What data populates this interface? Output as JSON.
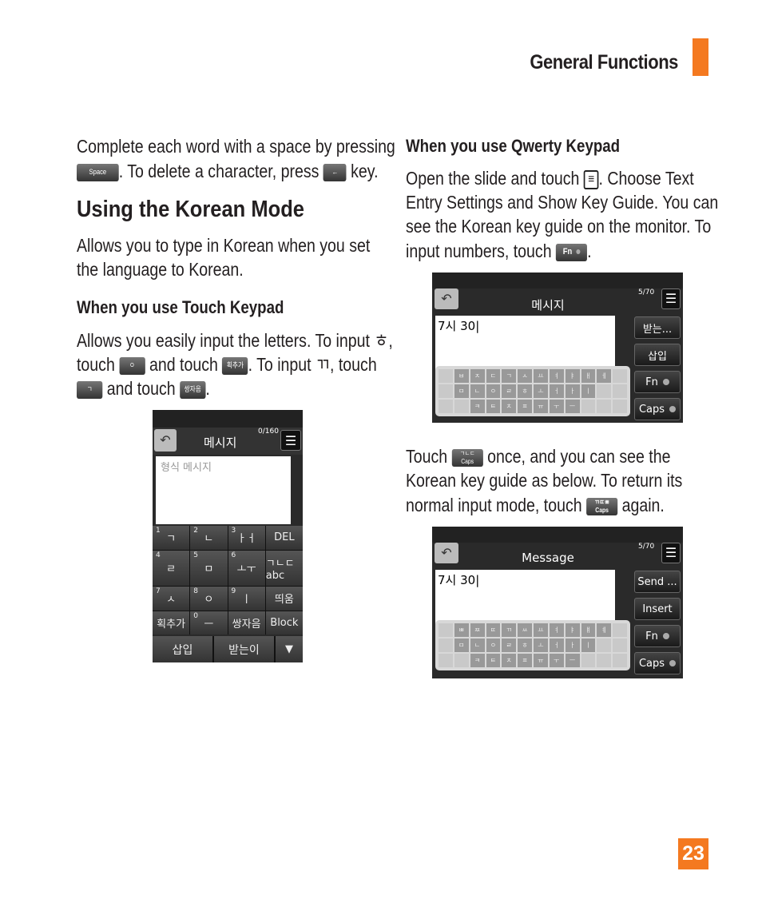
{
  "header": {
    "section": "General Functions",
    "accent": "#f47920"
  },
  "left": {
    "intro_line1": "Complete each word with a space by pressing",
    "intro_line2a": ". To delete a character, press",
    "intro_line2b": "key.",
    "key_space": "Space",
    "key_del": "Del",
    "title": "Using the Korean Mode",
    "desc1": "Allows you to type in Korean when you set",
    "desc2": "the language to Korean.",
    "touch_heading": "When you use Touch Keypad",
    "t1": "Allows you easily input the letters. To input ㅎ,",
    "t2a": "touch",
    "t2b": "and touch",
    "t2c": ". To input ㄲ, touch",
    "t3a": "and touch",
    "key8": "ㅇ",
    "key8n": "8",
    "key_add": "획추가",
    "key1": "ㄱ",
    "key1n": "1",
    "key_double": "쌍자음"
  },
  "right": {
    "qwerty_heading": "When you use Qwerty Keypad",
    "q1a": "Open the slide and touch",
    "q1b": ". Choose Text",
    "q2": "Entry Settings and Show Key Guide. You can",
    "q3": "see the Korean key guide on the monitor. To",
    "q4": "input numbers, touch",
    "key_fn": "Fn",
    "key_caps": "Caps",
    "key_caps_sub": "ㄱㄴㄷ",
    "key_caps_sub2": "ㄲㄸㅃ",
    "r1a": "Touch",
    "r1b": "once, and you can see the",
    "r2": "Korean key guide as below. To return its",
    "r3a": "normal input mode, touch",
    "r3b": "again."
  },
  "phone1": {
    "title": "메시지",
    "counter": "0/160",
    "placeholder": "형식 메시지",
    "keys": [
      [
        "1",
        "ㄱ"
      ],
      [
        "2",
        "ㄴ"
      ],
      [
        "3",
        "ㅏㅓ"
      ],
      [
        "",
        "DEL"
      ],
      [
        "4",
        "ㄹ"
      ],
      [
        "5",
        "ㅁ"
      ],
      [
        "6",
        "ㅗㅜ"
      ],
      [
        "",
        "ㄱㄴㄷ abc"
      ],
      [
        "7",
        "ㅅ"
      ],
      [
        "8",
        "ㅇ"
      ],
      [
        "9",
        "ㅣ"
      ],
      [
        "",
        "띄움"
      ],
      [
        "",
        "획추가"
      ],
      [
        "0",
        "ㅡ"
      ],
      [
        "",
        "쌍자음"
      ],
      [
        "",
        "Block"
      ]
    ],
    "bottom": [
      "삽입",
      "받는이"
    ]
  },
  "phone2": {
    "title": "메시지",
    "counter": "5/70",
    "text": "7시 30",
    "buttons": [
      "받는...",
      "삽입",
      "Fn",
      "Caps"
    ],
    "rows": [
      [
        "",
        "ㅂ",
        "ㅈ",
        "ㄷ",
        "ㄱ",
        "ㅅ",
        "ㅛ",
        "ㅕ",
        "ㅑ",
        "ㅐ",
        "ㅔ",
        ""
      ],
      [
        "",
        "ㅁ",
        "ㄴ",
        "ㅇ",
        "ㄹ",
        "ㅎ",
        "ㅗ",
        "ㅓ",
        "ㅏ",
        "ㅣ",
        "",
        ""
      ],
      [
        "",
        "",
        "ㅋ",
        "ㅌ",
        "ㅊ",
        "ㅍ",
        "ㅠ",
        "ㅜ",
        "ㅡ",
        "",
        "",
        ""
      ]
    ]
  },
  "phone3": {
    "title": "Message",
    "counter": "5/70",
    "text": "7시 30",
    "buttons": [
      "Send ...",
      "Insert",
      "Fn",
      "Caps"
    ],
    "rows": [
      [
        "",
        "ㅃ",
        "ㅉ",
        "ㄸ",
        "ㄲ",
        "ㅆ",
        "ㅛ",
        "ㅕ",
        "ㅑ",
        "ㅒ",
        "ㅖ",
        ""
      ],
      [
        "",
        "ㅁ",
        "ㄴ",
        "ㅇ",
        "ㄹ",
        "ㅎ",
        "ㅗ",
        "ㅓ",
        "ㅏ",
        "ㅣ",
        "",
        ""
      ],
      [
        "",
        "",
        "ㅋ",
        "ㅌ",
        "ㅊ",
        "ㅍ",
        "ㅠ",
        "ㅜ",
        "ㅡ",
        "",
        "",
        ""
      ]
    ]
  },
  "page_number": "23"
}
